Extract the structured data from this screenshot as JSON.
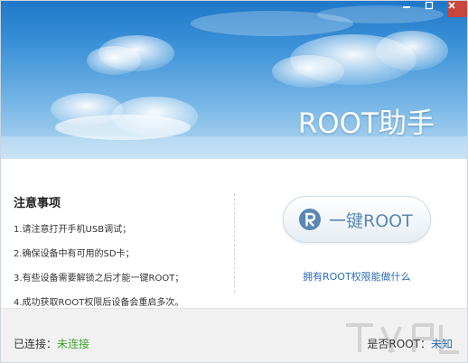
{
  "window": {
    "title": "ROOT助手",
    "controls": {
      "minimize_icon": "minimize-icon",
      "maximize_icon": "maximize-icon",
      "close_icon": "close-icon"
    }
  },
  "notes": {
    "heading": "注意事项",
    "items": [
      "1.请注意打开手机USB调试；",
      "2.确保设备中有可用的SD卡；",
      "3.有些设备需要解锁之后才能一键ROOT；",
      "4.成功获取ROOT权限后设备会重启多次。"
    ]
  },
  "action": {
    "button_label": "一键ROOT",
    "button_icon": "root-r-icon",
    "link": "拥有ROOT权限能做什么"
  },
  "status": {
    "connection_label": "已连接：",
    "connection_value": "未连接",
    "root_label": "是否ROOT：",
    "root_value": "未知"
  },
  "colors": {
    "sky_top": "#1f78c8",
    "sky_bottom": "#b9daf2",
    "link": "#2c6bb6",
    "connected_value": "#3da52a",
    "button_text": "#5a87b3",
    "close_button": "#c9463d"
  }
}
